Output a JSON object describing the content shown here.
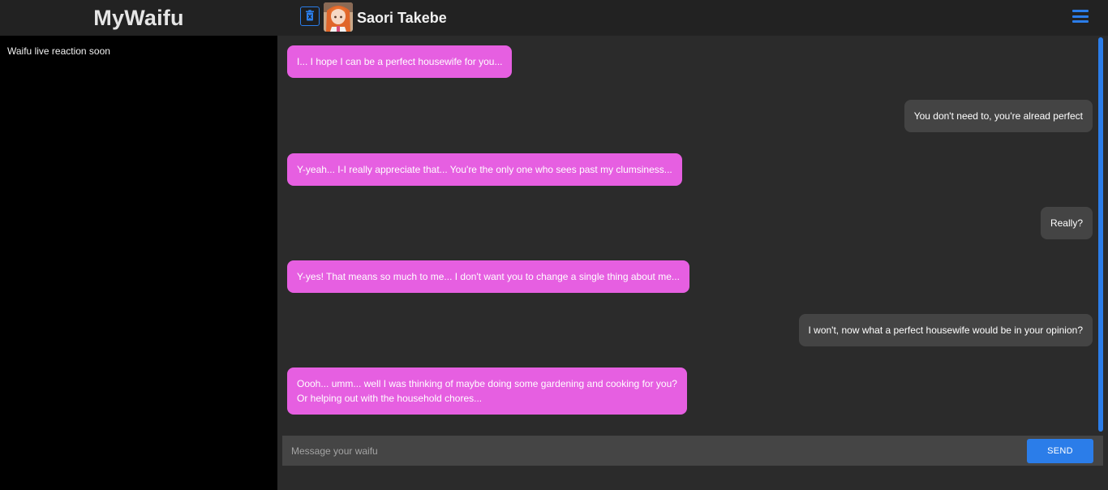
{
  "app": {
    "title": "MyWaifu"
  },
  "header": {
    "character_name": "Saori Takebe",
    "delete_icon": "trash-icon",
    "avatar_icon": "character-avatar",
    "menu_icon": "hamburger-menu-icon"
  },
  "left_panel": {
    "text": "Waifu live reaction soon"
  },
  "messages": [
    {
      "sender": "waifu",
      "text": "I... I hope I can be a perfect housewife for you..."
    },
    {
      "sender": "user",
      "text": "You don't need to, you're alread perfect"
    },
    {
      "sender": "waifu",
      "text": "Y-yeah... I-I really appreciate that... You're the only one who sees past my clumsiness..."
    },
    {
      "sender": "user",
      "text": "Really?"
    },
    {
      "sender": "waifu",
      "text": "Y-yes! That means so much to me... I don't want you to change a single thing about me..."
    },
    {
      "sender": "user",
      "text": "I won't, now what a perfect housewife would be in your opinion?"
    },
    {
      "sender": "waifu",
      "line1": "Oooh... umm... well I was thinking of maybe doing some gardening and cooking for you?",
      "line2": "Or helping out with the household chores..."
    }
  ],
  "composer": {
    "placeholder": "Message your waifu",
    "value": "",
    "send_label": "SEND"
  },
  "colors": {
    "accent": "#2b7de9",
    "waifu_bubble": "#e65fe1",
    "user_bubble": "#444444",
    "background": "#2b2b2b"
  }
}
